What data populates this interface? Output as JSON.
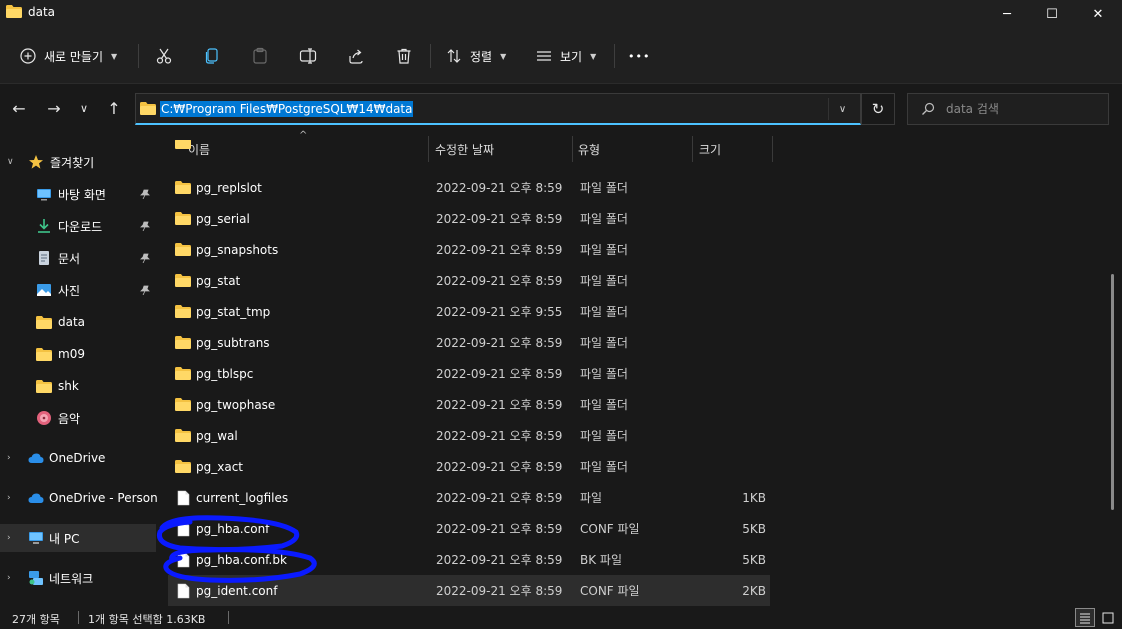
{
  "window": {
    "title": "data",
    "minimize_icon": "─",
    "maximize_icon": "☐",
    "close_icon": "✕"
  },
  "toolbar": {
    "new_label": "새로 만들기",
    "sort_label": "정렬",
    "view_label": "보기",
    "more_icon": "•••"
  },
  "address": {
    "path": "C:₩Program Files₩PostgreSQL₩14₩data",
    "search_placeholder": "data 검색"
  },
  "sidebar": {
    "items": [
      {
        "label": "즐겨찾기",
        "icon": "star-icon"
      },
      {
        "label": "바탕 화면",
        "icon": "desktop-icon"
      },
      {
        "label": "다운로드",
        "icon": "download-icon"
      },
      {
        "label": "문서",
        "icon": "document-icon"
      },
      {
        "label": "사진",
        "icon": "pictures-icon"
      },
      {
        "label": "data",
        "icon": "folder-icon"
      },
      {
        "label": "m09",
        "icon": "folder-icon"
      },
      {
        "label": "shk",
        "icon": "folder-icon"
      },
      {
        "label": "음악",
        "icon": "music-icon"
      },
      {
        "label": "OneDrive",
        "icon": "cloud-icon"
      },
      {
        "label": "OneDrive - Persona",
        "icon": "cloud-icon"
      },
      {
        "label": "내 PC",
        "icon": "pc-icon"
      },
      {
        "label": "네트워크",
        "icon": "network-icon"
      }
    ]
  },
  "columns": {
    "name": "이름",
    "date": "수정한 날짜",
    "type": "유형",
    "size": "크기"
  },
  "files": [
    {
      "name": "pg_replslot",
      "date": "2022-09-21 오후 8:59",
      "type": "파일 폴더",
      "size": "",
      "kind": "folder"
    },
    {
      "name": "pg_serial",
      "date": "2022-09-21 오후 8:59",
      "type": "파일 폴더",
      "size": "",
      "kind": "folder"
    },
    {
      "name": "pg_snapshots",
      "date": "2022-09-21 오후 8:59",
      "type": "파일 폴더",
      "size": "",
      "kind": "folder"
    },
    {
      "name": "pg_stat",
      "date": "2022-09-21 오후 8:59",
      "type": "파일 폴더",
      "size": "",
      "kind": "folder"
    },
    {
      "name": "pg_stat_tmp",
      "date": "2022-09-21 오후 9:55",
      "type": "파일 폴더",
      "size": "",
      "kind": "folder"
    },
    {
      "name": "pg_subtrans",
      "date": "2022-09-21 오후 8:59",
      "type": "파일 폴더",
      "size": "",
      "kind": "folder"
    },
    {
      "name": "pg_tblspc",
      "date": "2022-09-21 오후 8:59",
      "type": "파일 폴더",
      "size": "",
      "kind": "folder"
    },
    {
      "name": "pg_twophase",
      "date": "2022-09-21 오후 8:59",
      "type": "파일 폴더",
      "size": "",
      "kind": "folder"
    },
    {
      "name": "pg_wal",
      "date": "2022-09-21 오후 8:59",
      "type": "파일 폴더",
      "size": "",
      "kind": "folder"
    },
    {
      "name": "pg_xact",
      "date": "2022-09-21 오후 8:59",
      "type": "파일 폴더",
      "size": "",
      "kind": "folder"
    },
    {
      "name": "current_logfiles",
      "date": "2022-09-21 오후 8:59",
      "type": "파일",
      "size": "1KB",
      "kind": "file"
    },
    {
      "name": "pg_hba.conf",
      "date": "2022-09-21 오후 8:59",
      "type": "CONF 파일",
      "size": "5KB",
      "kind": "file"
    },
    {
      "name": "pg_hba.conf.bk",
      "date": "2022-09-21 오후 8:59",
      "type": "BK 파일",
      "size": "5KB",
      "kind": "file"
    },
    {
      "name": "pg_ident.conf",
      "date": "2022-09-21 오후 8:59",
      "type": "CONF 파일",
      "size": "2KB",
      "kind": "file"
    }
  ],
  "status": {
    "count": "27개 항목",
    "selection": "1개 항목 선택함 1.63KB"
  },
  "colors": {
    "accent": "#0078d4",
    "folder": "#f4c242",
    "annotation": "#0a1aff"
  }
}
